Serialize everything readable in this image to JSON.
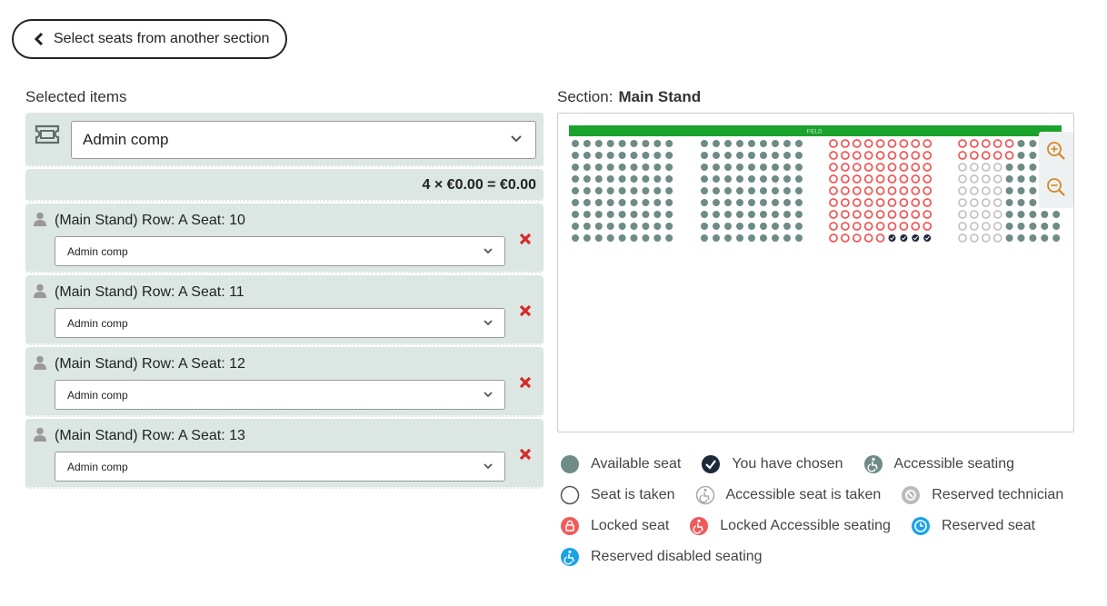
{
  "back_button": {
    "label": "Select seats from another section"
  },
  "selected_items": {
    "title": "Selected items",
    "ticket_type": "Admin comp",
    "total": "4 × €0.00 = €0.00",
    "seats": [
      {
        "label": "(Main Stand) Row: A Seat: 10",
        "ticket": "Admin comp"
      },
      {
        "label": "(Main Stand) Row: A Seat: 11",
        "ticket": "Admin comp"
      },
      {
        "label": "(Main Stand) Row: A Seat: 12",
        "ticket": "Admin comp"
      },
      {
        "label": "(Main Stand) Row: A Seat: 13",
        "ticket": "Admin comp"
      }
    ]
  },
  "section": {
    "label": "Section:",
    "name": "Main Stand",
    "field_label": "FIELD"
  },
  "legend": [
    {
      "icon": "available-seat-icon",
      "label": "Available seat",
      "color": "#6e8b86"
    },
    {
      "icon": "chosen-seat-icon",
      "label": "You have chosen",
      "color": "#1c2a3a"
    },
    {
      "icon": "accessible-seat-icon",
      "label": "Accessible seating",
      "color": "#6e8b86"
    },
    {
      "icon": "taken-seat-icon",
      "label": "Seat is taken",
      "color": "#ffffff"
    },
    {
      "icon": "accessible-taken-icon",
      "label": "Accessible seat is taken",
      "color": "#ffffff"
    },
    {
      "icon": "reserved-technician-icon",
      "label": "Reserved technician",
      "color": "#bbbbbb"
    },
    {
      "icon": "locked-seat-icon",
      "label": "Locked seat",
      "color": "#ef5a5a"
    },
    {
      "icon": "locked-accessible-icon",
      "label": "Locked Accessible seating",
      "color": "#ef5a5a"
    },
    {
      "icon": "reserved-seat-icon",
      "label": "Reserved seat",
      "color": "#1aa3e8"
    },
    {
      "icon": "reserved-disabled-icon",
      "label": "Reserved disabled seating",
      "color": "#1aa3e8"
    }
  ],
  "colors": {
    "field": "#1aa32c",
    "available": "#6e8b86",
    "locked": "#ef5a5a",
    "chosen": "#1c2a3a",
    "technician": "#c4c4c4",
    "remove": "#d42a2a"
  }
}
